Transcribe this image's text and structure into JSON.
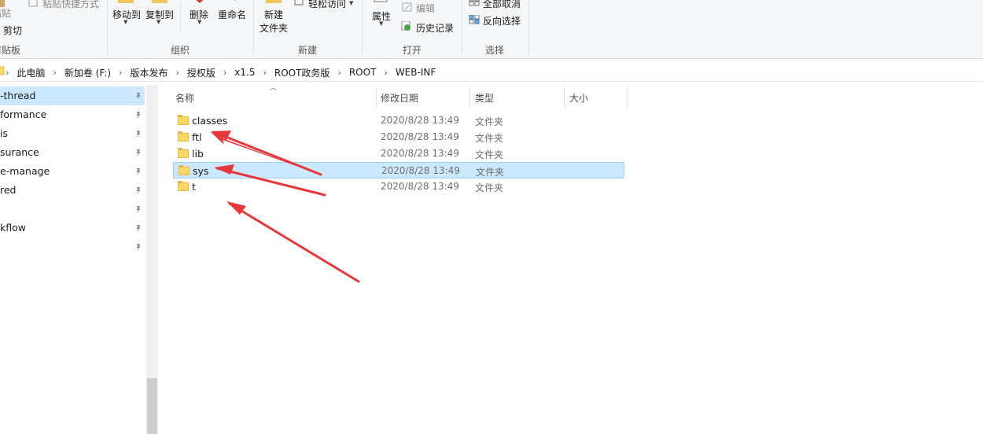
{
  "ribbon": {
    "clipboard": {
      "paste_label": "粘贴",
      "paste_shortcut_label": "粘贴快捷方式",
      "cut_label": "剪切",
      "group_label": "剪贴板"
    },
    "organize": {
      "move_to_label": "移动到",
      "copy_to_label": "复制到",
      "delete_label": "删除",
      "rename_label": "重命名",
      "group_label": "组织"
    },
    "new": {
      "new_folder_label_1": "新建",
      "new_folder_label_2": "文件夹",
      "easy_access_label": "轻松访问",
      "group_label": "新建"
    },
    "open": {
      "properties_label": "属性",
      "edit_label": "编辑",
      "history_label": "历史记录",
      "group_label": "打开"
    },
    "select": {
      "select_none_label": "全部取消",
      "invert_selection_label": "反向选择",
      "group_label": "选择"
    }
  },
  "breadcrumb": [
    "此电脑",
    "新加卷 (F:)",
    "版本发布",
    "授权版",
    "x1.5",
    "ROOT政务版",
    "ROOT",
    "WEB-INF"
  ],
  "nav_items": [
    {
      "label": "-thread",
      "selected": true
    },
    {
      "label": "formance",
      "selected": false
    },
    {
      "label": "is",
      "selected": false
    },
    {
      "label": "surance",
      "selected": false
    },
    {
      "label": "e-manage",
      "selected": false
    },
    {
      "label": "red",
      "selected": false
    },
    {
      "label": "",
      "selected": false
    },
    {
      "label": "kflow",
      "selected": false
    },
    {
      "label": "",
      "selected": false
    }
  ],
  "columns": {
    "name": "名称",
    "date": "修改日期",
    "type": "类型",
    "size": "大小"
  },
  "files": [
    {
      "name": "classes",
      "date": "2020/8/28 13:49",
      "type": "文件夹",
      "selected": false
    },
    {
      "name": "ftl",
      "date": "2020/8/28 13:49",
      "type": "文件夹",
      "selected": false
    },
    {
      "name": "lib",
      "date": "2020/8/28 13:49",
      "type": "文件夹",
      "selected": false
    },
    {
      "name": "sys",
      "date": "2020/8/28 13:49",
      "type": "文件夹",
      "selected": true
    },
    {
      "name": "t",
      "date": "2020/8/28 13:49",
      "type": "文件夹",
      "selected": false
    }
  ],
  "colors": {
    "selection": "#cce8ff",
    "annotation_arrow": "#e8373a",
    "folder": "#ffd766"
  }
}
